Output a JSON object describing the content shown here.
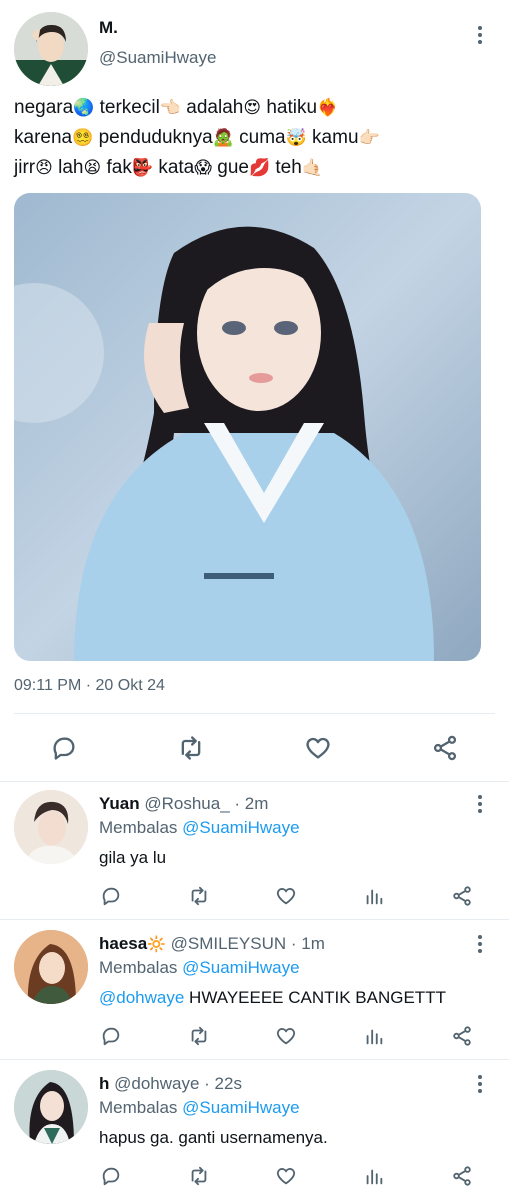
{
  "tweet": {
    "name": "M.",
    "handle": "@SuamiHwaye",
    "text_lines": [
      [
        [
          "negara",
          "🌏"
        ],
        [
          "terkecil",
          "👈🏻"
        ],
        [
          "adalah",
          "😍"
        ],
        [
          "hatiku",
          "❤️‍🔥"
        ]
      ],
      [
        [
          "karena",
          "😵‍💫"
        ],
        [
          "penduduknya",
          "🧟"
        ],
        [
          "cuma",
          "🤯"
        ],
        [
          "kamu",
          "👉🏻"
        ]
      ],
      [
        [
          "jirr",
          "😠"
        ],
        [
          "lah",
          "😫"
        ],
        [
          "fak",
          "👺"
        ],
        [
          "kata",
          "😱"
        ],
        [
          "gue",
          "💋"
        ],
        [
          "teh",
          "🤙🏻"
        ]
      ]
    ],
    "timestamp": "09:11 PM · 20 Okt 24",
    "icons": [
      "more-icon",
      "reply-icon",
      "retweet-icon",
      "like-icon",
      "share-icon"
    ]
  },
  "replies": [
    {
      "name": "Yuan",
      "handle": "@Roshua_",
      "time": "· 2m",
      "replying_label": "Membalas",
      "replying_to": "@SuamiHwaye",
      "mention": "",
      "text": "gila ya lu",
      "avatar_color": "#efe6de"
    },
    {
      "name": "haesa",
      "name_emoji": "🔆",
      "handle": "@SMILEYSUN",
      "time": "· 1m",
      "replying_label": "Membalas",
      "replying_to": "@SuamiHwaye",
      "mention": "@dohwaye",
      "text": "HWAYEEEE CANTIK BANGETTT",
      "avatar_color": "#e7b48a"
    },
    {
      "name": "h",
      "handle": "@dohwaye",
      "time": "· 22s",
      "replying_label": "Membalas",
      "replying_to": "@SuamiHwaye",
      "mention": "",
      "text": "hapus ga. ganti usernamenya.",
      "avatar_color": "#c9d8d6"
    }
  ],
  "colors": {
    "accent": "#1d9bf0",
    "secondary_text": "#536471",
    "divider": "#e6ecf0"
  }
}
